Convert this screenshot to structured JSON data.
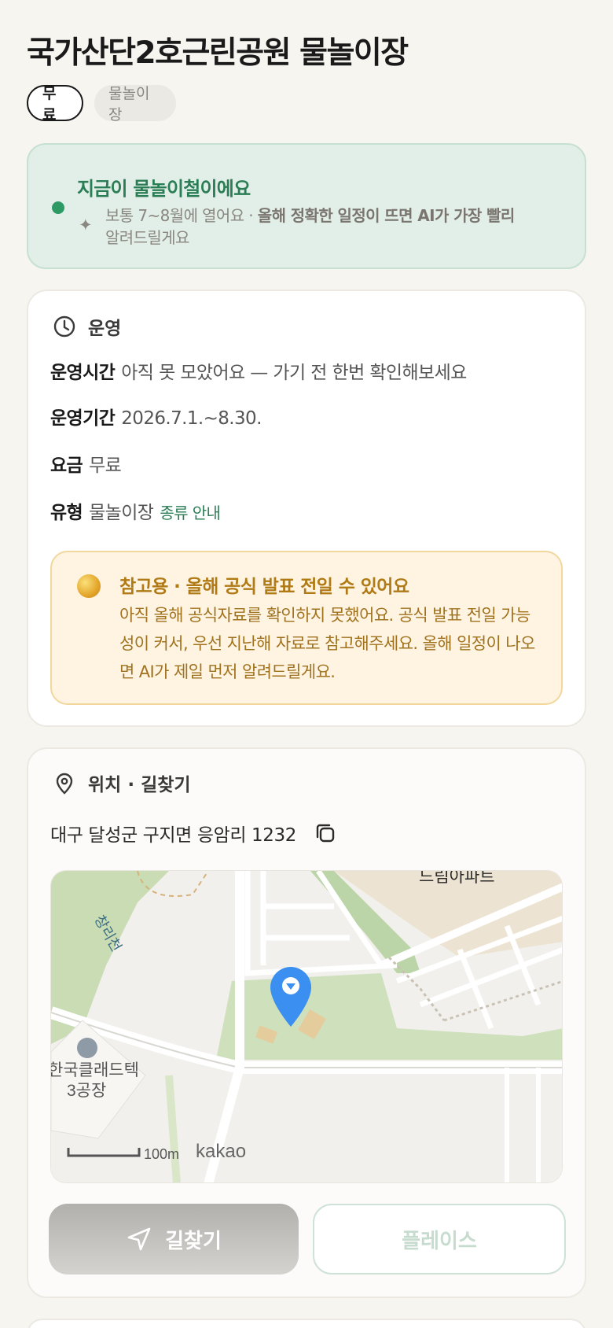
{
  "page": {
    "title": "국가산단2호근린공원 물놀이장"
  },
  "chips": {
    "fee": "무료",
    "type": "물놀이장"
  },
  "season": {
    "headline": "지금이 물놀이철이에요",
    "desc_plain": "보통 7~8월에 열어요 · ",
    "desc_bold": "올해 정확한 일정이 뜨면 AI가 가장 빨리",
    "desc_tail": "알려드릴게요",
    "accent_color": "#2d9a66"
  },
  "operation": {
    "section_title": "운영",
    "hours_label": "운영시간",
    "hours_value": "아직 못 모았어요 — 가기 전 한번 확인해보세요",
    "period_label": "운영기간",
    "period_value": "2026.7.1.~8.30.",
    "fee_label": "요금",
    "fee_value": "무료",
    "type_label": "유형",
    "type_value": "물놀이장",
    "type_link": "종류 안내"
  },
  "notice": {
    "title": "참고용 · 올해 공식 발표 전일 수 있어요",
    "body": "아직 올해 공식자료를 확인하지 못했어요. 공식 발표 전일 가능성이 커서, 우선 지난해 자료로 참고해주세요. 올해 일정이 나오면 AI가 제일 먼저 알려드릴게요."
  },
  "location": {
    "section_title": "위치 · 길찾기",
    "address": "대구 달성군 구지면 응암리 1232",
    "copy_icon": "copy-icon"
  },
  "map": {
    "label_apartment": "드림아파트",
    "label_stream": "창리천",
    "label_factory_line1": "한국클래드텍",
    "label_factory_line2": "3공장",
    "scale_label": "100m",
    "provider_logo": "kakao",
    "pin_color": "#3b8ff0"
  },
  "actions": {
    "directions": "길찾기",
    "place": "플레이스"
  }
}
